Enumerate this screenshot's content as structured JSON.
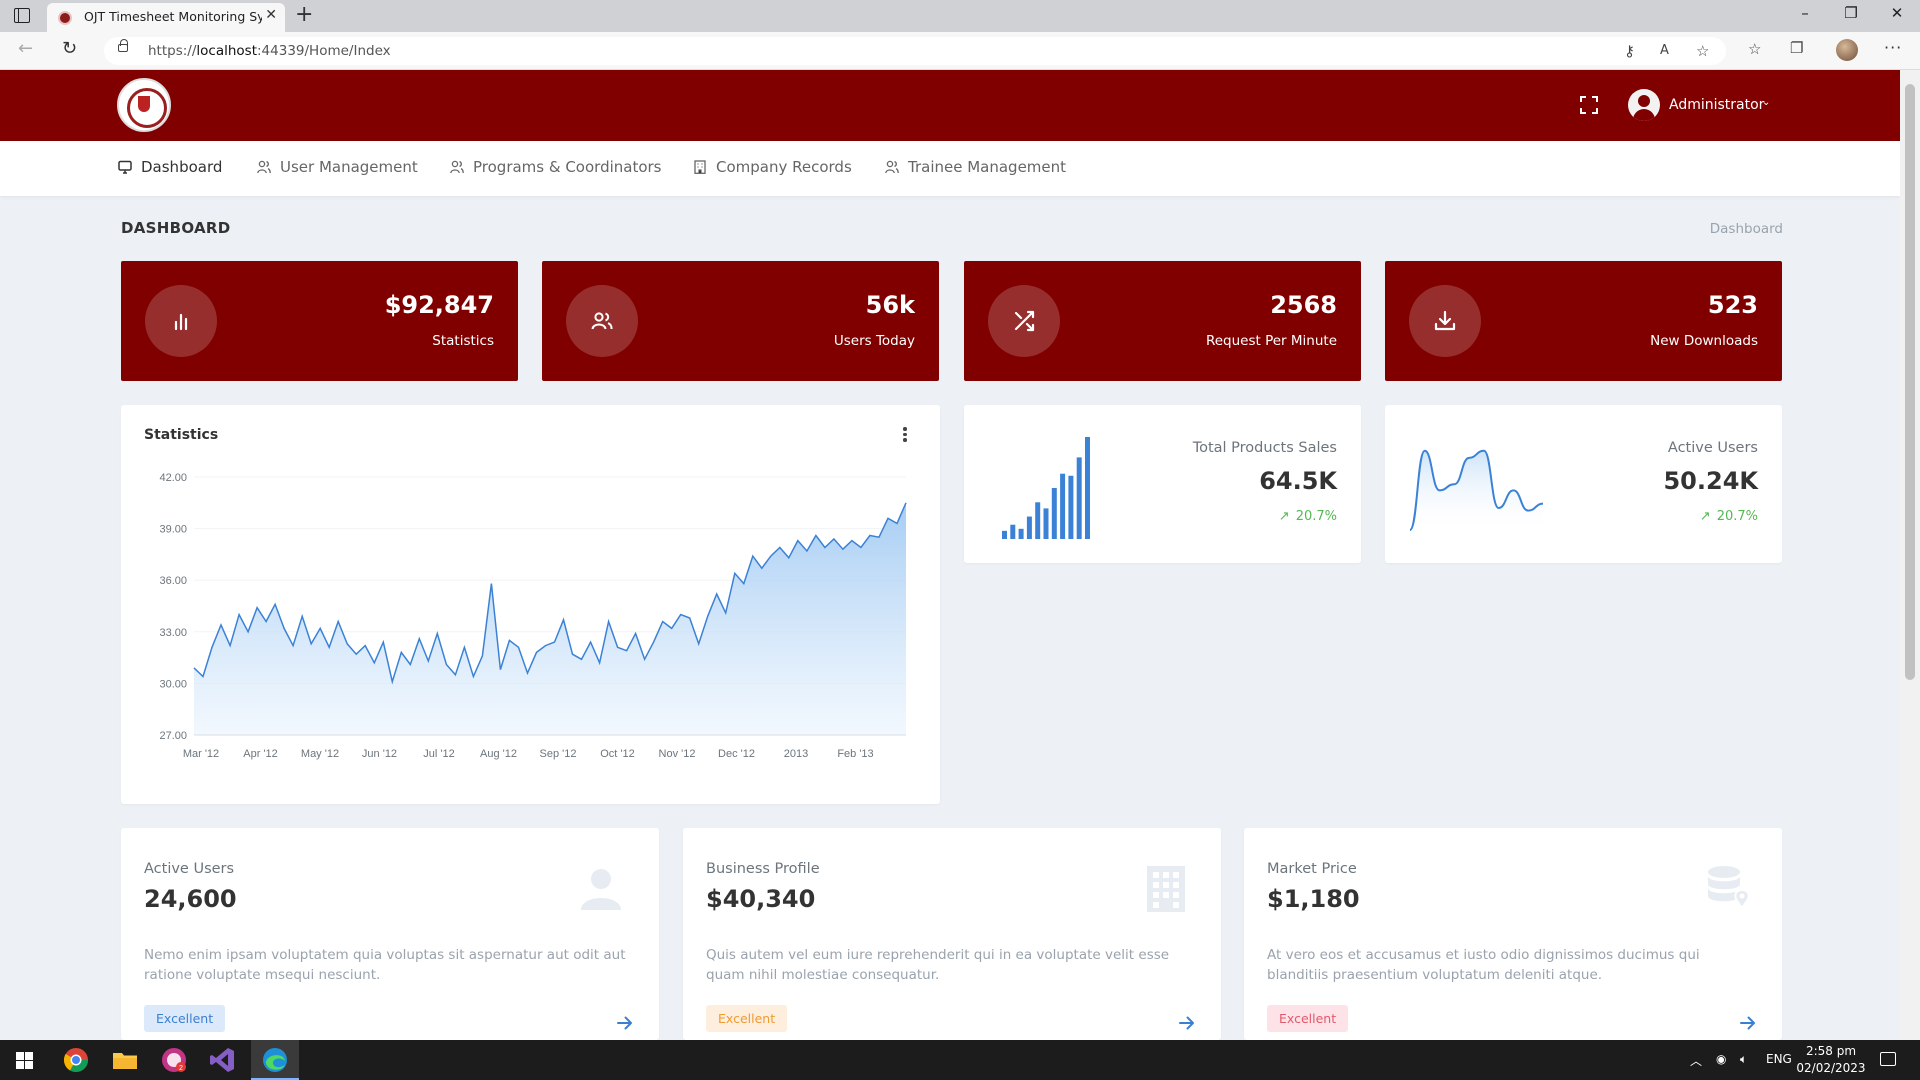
{
  "browser": {
    "tab_title": "OJT Timesheet Monitoring System",
    "new_tab": "+",
    "close_tab": "✕",
    "url_prefix": "https://",
    "url_host": "localhost",
    "url_rest": ":44339/Home/Index",
    "window_controls": [
      "–",
      "❐",
      "✕"
    ]
  },
  "header": {
    "user_name": "Administrator"
  },
  "nav": {
    "items": [
      {
        "label": "Dashboard",
        "icon": "monitor-icon"
      },
      {
        "label": "User Management",
        "icon": "users-icon"
      },
      {
        "label": "Programs & Coordinators",
        "icon": "users-icon"
      },
      {
        "label": "Company Records",
        "icon": "building-icon"
      },
      {
        "label": "Trainee Management",
        "icon": "users-icon"
      }
    ]
  },
  "page": {
    "title": "DASHBOARD",
    "breadcrumb": "Dashboard"
  },
  "stats": [
    {
      "value": "$92,847",
      "label": "Statistics",
      "icon": "bar-chart-icon"
    },
    {
      "value": "56k",
      "label": "Users Today",
      "icon": "users-icon"
    },
    {
      "value": "2568",
      "label": "Request Per Minute",
      "icon": "shuffle-icon"
    },
    {
      "value": "523",
      "label": "New Downloads",
      "icon": "download-icon"
    }
  ],
  "statistics_card": {
    "title": "Statistics"
  },
  "mini_cards": [
    {
      "label": "Total Products Sales",
      "value": "64.5K",
      "trend": "20.7%"
    },
    {
      "label": "Active Users",
      "value": "50.24K",
      "trend": "20.7%"
    }
  ],
  "mini_bars": [
    0.08,
    0.14,
    0.1,
    0.22,
    0.36,
    0.3,
    0.5,
    0.64,
    0.62,
    0.8,
    1.0
  ],
  "info_cards": [
    {
      "label": "Active Users",
      "value": "24,600",
      "icon": "user-icon",
      "description": "Nemo enim ipsam voluptatem quia voluptas sit aspernatur aut odit aut ratione voluptate msequi nesciunt.",
      "badge": "Excellent"
    },
    {
      "label": "Business Profile",
      "value": "$40,340",
      "icon": "building-icon",
      "description": "Quis autem vel eum iure reprehenderit qui in ea voluptate velit esse quam nihil molestiae consequatur.",
      "badge": "Excellent"
    },
    {
      "label": "Market Price",
      "value": "$1,180",
      "icon": "database-location-icon",
      "description": "At vero eos et accusamus et iusto odio dignissimos ducimus qui blanditiis praesentium voluptatum deleniti atque.",
      "badge": "Excellent"
    }
  ],
  "colors": {
    "brand": "#800000",
    "chart_line": "#3b82d6",
    "trend_up": "#55b754"
  },
  "chart_data": [
    {
      "type": "area",
      "title": "Statistics",
      "xlabel": "",
      "ylabel": "",
      "x_tick_labels": [
        "Mar '12",
        "Apr '12",
        "May '12",
        "Jun '12",
        "Jul '12",
        "Aug '12",
        "Sep '12",
        "Oct '12",
        "Nov '12",
        "Dec '12",
        "2013",
        "Feb '13"
      ],
      "y_tick_labels": [
        "27.00",
        "30.00",
        "33.00",
        "36.00",
        "39.00",
        "42.00"
      ],
      "ylim": [
        27,
        42
      ],
      "grid": true,
      "series": [
        {
          "values": [
            30.9,
            30.4,
            32.1,
            33.4,
            32.2,
            34.0,
            33.0,
            34.4,
            33.6,
            34.6,
            33.2,
            32.2,
            33.9,
            32.3,
            33.2,
            32.1,
            33.6,
            32.3,
            31.7,
            32.2,
            31.2,
            32.4,
            30.1,
            31.8,
            31.1,
            32.6,
            31.3,
            32.9,
            31.1,
            30.5,
            32.1,
            30.4,
            31.6,
            35.8,
            30.8,
            32.5,
            32.1,
            30.6,
            31.8,
            32.2,
            32.4,
            33.7,
            31.7,
            31.4,
            32.4,
            31.2,
            33.6,
            32.1,
            31.9,
            32.9,
            31.4,
            32.4,
            33.6,
            33.2,
            34.0,
            33.8,
            32.3,
            33.9,
            35.2,
            34.1,
            36.4,
            35.8,
            37.4,
            36.7,
            37.4,
            37.9,
            37.3,
            38.3,
            37.7,
            38.6,
            37.9,
            38.4,
            37.8,
            38.3,
            37.9,
            38.6,
            38.5,
            39.6,
            39.3,
            40.5
          ]
        }
      ]
    },
    {
      "type": "bar",
      "values": [
        0.08,
        0.14,
        0.1,
        0.22,
        0.36,
        0.3,
        0.5,
        0.64,
        0.62,
        0.8,
        1.0
      ]
    },
    {
      "type": "line",
      "values": [
        0.0,
        0.9,
        0.45,
        0.52,
        0.82,
        0.9,
        0.25,
        0.45,
        0.22,
        0.3
      ]
    }
  ]
}
